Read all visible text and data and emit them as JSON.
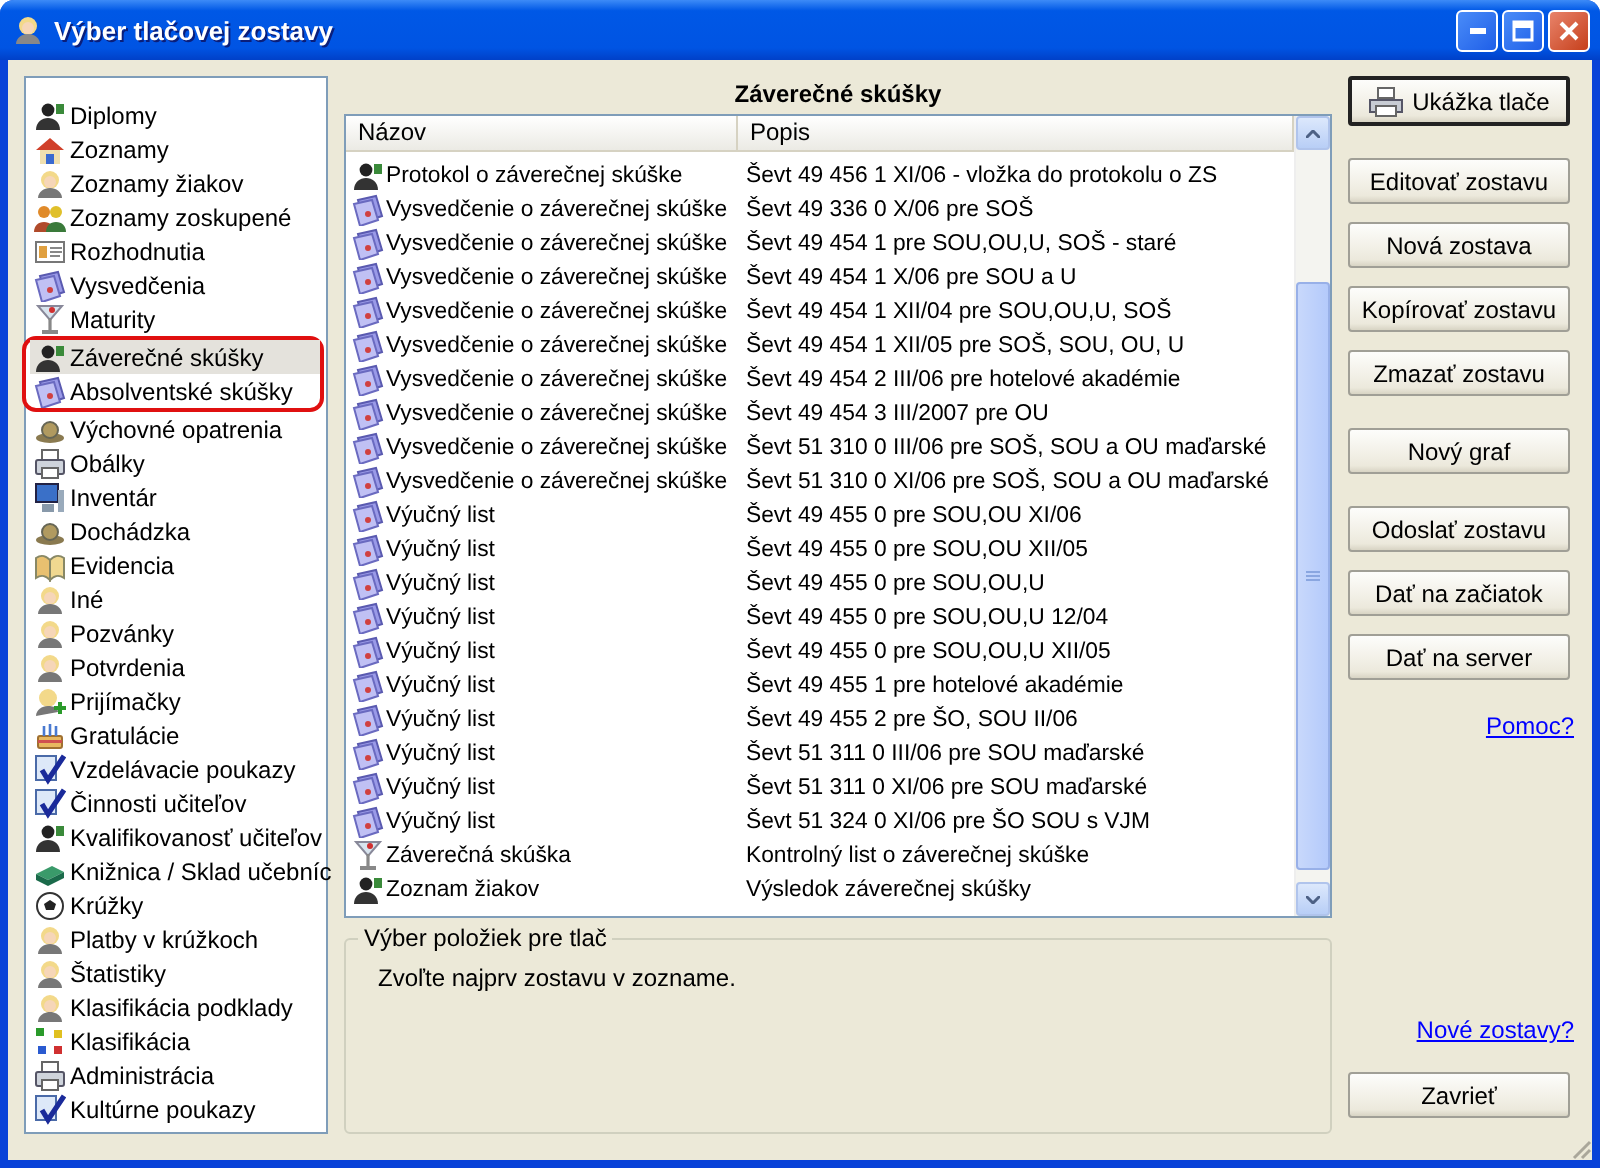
{
  "window": {
    "title": "Výber tlačovej zostavy"
  },
  "sidebar": {
    "items": [
      {
        "label": "Diplomy",
        "kind": "person",
        "selected": false,
        "circled": false
      },
      {
        "label": "Zoznamy",
        "kind": "house",
        "selected": false,
        "circled": false
      },
      {
        "label": "Zoznamy žiakov",
        "kind": "face",
        "selected": false,
        "circled": false
      },
      {
        "label": "Zoznamy zoskupené",
        "kind": "people",
        "selected": false,
        "circled": false
      },
      {
        "label": "Rozhodnutia",
        "kind": "card",
        "selected": false,
        "circled": false
      },
      {
        "label": "Vysvedčenia",
        "kind": "certificate",
        "selected": false,
        "circled": false
      },
      {
        "label": "Maturity",
        "kind": "goblet",
        "selected": false,
        "circled": false
      },
      {
        "label": "Záverečné skúšky",
        "kind": "person",
        "selected": true,
        "circled": true
      },
      {
        "label": "Absolventské skúšky",
        "kind": "certificate",
        "selected": false,
        "circled": true
      },
      {
        "label": "Výchovné opatrenia",
        "kind": "snail",
        "selected": false,
        "circled": false
      },
      {
        "label": "Obálky",
        "kind": "printer",
        "selected": false,
        "circled": false
      },
      {
        "label": "Inventár",
        "kind": "computer",
        "selected": false,
        "circled": false
      },
      {
        "label": "Dochádzka",
        "kind": "snail",
        "selected": false,
        "circled": false
      },
      {
        "label": "Evidencia",
        "kind": "book",
        "selected": false,
        "circled": false
      },
      {
        "label": "Iné",
        "kind": "face",
        "selected": false,
        "circled": false
      },
      {
        "label": "Pozvánky",
        "kind": "face",
        "selected": false,
        "circled": false
      },
      {
        "label": "Potvrdenia",
        "kind": "face",
        "selected": false,
        "circled": false
      },
      {
        "label": "Prijímačky",
        "kind": "faceplus",
        "selected": false,
        "circled": false
      },
      {
        "label": "Gratulácie",
        "kind": "cake",
        "selected": false,
        "circled": false
      },
      {
        "label": "Vzdelávacie poukazy",
        "kind": "check",
        "selected": false,
        "circled": false
      },
      {
        "label": "Činnosti učiteľov",
        "kind": "check",
        "selected": false,
        "circled": false
      },
      {
        "label": "Kvalifikovanosť učiteľov",
        "kind": "person",
        "selected": false,
        "circled": false
      },
      {
        "label": "Knižnica / Sklad učebníc",
        "kind": "books",
        "selected": false,
        "circled": false
      },
      {
        "label": "Krúžky",
        "kind": "ball",
        "selected": false,
        "circled": false
      },
      {
        "label": "Platby v krúžkoch",
        "kind": "face",
        "selected": false,
        "circled": false
      },
      {
        "label": "Štatistiky",
        "kind": "face",
        "selected": false,
        "circled": false
      },
      {
        "label": "Klasifikácia podklady",
        "kind": "face",
        "selected": false,
        "circled": false
      },
      {
        "label": "Klasifikácia",
        "kind": "letters",
        "selected": false,
        "circled": false
      },
      {
        "label": "Administrácia",
        "kind": "printer",
        "selected": false,
        "circled": false
      },
      {
        "label": "Kultúrne poukazy",
        "kind": "check",
        "selected": false,
        "circled": false
      }
    ]
  },
  "report_list": {
    "title": "Záverečné skúšky",
    "columns": [
      "Názov",
      "Popis"
    ],
    "rows": [
      {
        "kind": "person",
        "name": "Protokol o záverečnej skúške",
        "description": "Ševt 49 456 1 XI/06 - vložka do protokolu o ZS"
      },
      {
        "kind": "certificate",
        "name": "Vysvedčenie o záverečnej skúške",
        "description": "Ševt 49 336 0 X/06 pre SOŠ"
      },
      {
        "kind": "certificate",
        "name": "Vysvedčenie o záverečnej skúške",
        "description": "Ševt 49 454 1 pre SOU,OU,U, SOŠ - staré"
      },
      {
        "kind": "certificate",
        "name": "Vysvedčenie o záverečnej skúške",
        "description": "Ševt 49 454 1 X/06 pre SOU a U"
      },
      {
        "kind": "certificate",
        "name": "Vysvedčenie o záverečnej skúške",
        "description": "Ševt 49 454 1 XII/04 pre SOU,OU,U, SOŠ"
      },
      {
        "kind": "certificate",
        "name": "Vysvedčenie o záverečnej skúške",
        "description": "Ševt 49 454 1 XII/05 pre SOŠ, SOU, OU, U"
      },
      {
        "kind": "certificate",
        "name": "Vysvedčenie o záverečnej skúške",
        "description": "Ševt 49 454 2 III/06 pre hotelové akadémie"
      },
      {
        "kind": "certificate",
        "name": "Vysvedčenie o záverečnej skúške",
        "description": "Ševt 49 454 3 III/2007 pre OU"
      },
      {
        "kind": "certificate",
        "name": "Vysvedčenie o záverečnej skúške",
        "description": "Ševt 51 310 0 III/06 pre SOŠ, SOU a OU maďarské"
      },
      {
        "kind": "certificate",
        "name": "Vysvedčenie o záverečnej skúške",
        "description": "Ševt 51 310 0 XI/06 pre SOŠ, SOU a OU maďarské"
      },
      {
        "kind": "certificate",
        "name": "Výučný list",
        "description": "Ševt 49 455 0 pre SOU,OU XI/06"
      },
      {
        "kind": "certificate",
        "name": "Výučný list",
        "description": "Ševt 49 455 0 pre SOU,OU XII/05"
      },
      {
        "kind": "certificate",
        "name": "Výučný list",
        "description": "Ševt 49 455 0 pre SOU,OU,U"
      },
      {
        "kind": "certificate",
        "name": "Výučný list",
        "description": "Ševt 49 455 0 pre SOU,OU,U 12/04"
      },
      {
        "kind": "certificate",
        "name": "Výučný list",
        "description": "Ševt 49 455 0 pre SOU,OU,U XII/05"
      },
      {
        "kind": "certificate",
        "name": "Výučný list",
        "description": "Ševt 49 455 1 pre hotelové akadémie"
      },
      {
        "kind": "certificate",
        "name": "Výučný list",
        "description": "Ševt 49 455 2 pre ŠO, SOU II/06"
      },
      {
        "kind": "certificate",
        "name": "Výučný list",
        "description": "Ševt 51 311 0 III/06 pre SOU maďarské"
      },
      {
        "kind": "certificate",
        "name": "Výučný list",
        "description": "Ševt 51 311 0 XI/06 pre SOU maďarské"
      },
      {
        "kind": "certificate",
        "name": "Výučný list",
        "description": "Ševt 51 324 0 XI/06 pre ŠO SOU s VJM"
      },
      {
        "kind": "goblet",
        "name": "Záverečná skúška",
        "description": "Kontrolný list o záverečnej skúške"
      },
      {
        "kind": "person",
        "name": "Zoznam žiakov",
        "description": "Výsledok záverečnej skúšky"
      }
    ]
  },
  "print_items": {
    "legend": "Výber položiek pre tlač",
    "message": "Zvoľte najprv zostavu v zozname."
  },
  "action_groups": [
    [
      {
        "label": "Ukážka tlače",
        "kind": "preview",
        "default": true
      }
    ],
    [
      {
        "label": "Editovať zostavu",
        "kind": "plain",
        "default": false
      },
      {
        "label": "Nová zostava",
        "kind": "plain",
        "default": false
      },
      {
        "label": "Kopírovať zostavu",
        "kind": "plain",
        "default": false
      },
      {
        "label": "Zmazať zostavu",
        "kind": "plain",
        "default": false
      }
    ],
    [
      {
        "label": "Nový graf",
        "kind": "plain",
        "default": false
      }
    ],
    [
      {
        "label": "Odoslať zostavu",
        "kind": "plain",
        "default": false
      },
      {
        "label": "Dať na začiatok",
        "kind": "plain",
        "default": false
      },
      {
        "label": "Dať na server",
        "kind": "plain",
        "default": false
      }
    ]
  ],
  "help_link": "Pomoc?",
  "new_reports_link": "Nové zostavy?",
  "close_button": "Zavrieť"
}
